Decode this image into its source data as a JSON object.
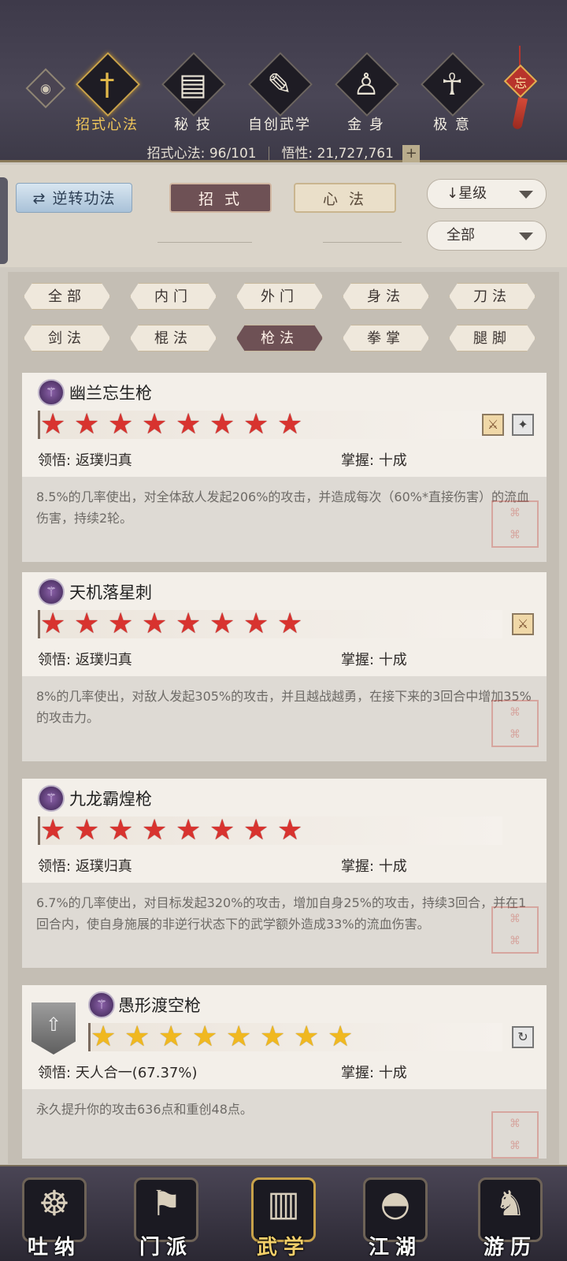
{
  "header": {
    "tabs": [
      {
        "label": "招式心法",
        "icon": "sword-icon",
        "glyph": "†",
        "active": true
      },
      {
        "label": "秘 技",
        "icon": "book-icon",
        "glyph": "▤",
        "active": false
      },
      {
        "label": "自创武学",
        "icon": "scroll-icon",
        "glyph": "✎",
        "active": false
      },
      {
        "label": "金 身",
        "icon": "meditation-icon",
        "glyph": "♙",
        "active": false
      },
      {
        "label": "极 意",
        "icon": "martial-pose-icon",
        "glyph": "☥",
        "active": false
      }
    ],
    "charm_text": "忘",
    "stats": {
      "moves_label": "招式心法:",
      "moves_value": "96/101",
      "insight_label": "悟性:",
      "insight_value": "21,727,761",
      "plus": "+"
    }
  },
  "controls": {
    "reverse_label": "逆转功法",
    "reverse_glyph": "⇄",
    "tab_moves": "招 式",
    "tab_mind": "心 法",
    "sort_value": "↓星级",
    "filter_value": "全部"
  },
  "filters": [
    {
      "label": "全部",
      "active": false
    },
    {
      "label": "内门",
      "active": false
    },
    {
      "label": "外门",
      "active": false
    },
    {
      "label": "身法",
      "active": false
    },
    {
      "label": "刀法",
      "active": false
    },
    {
      "label": "剑法",
      "active": false
    },
    {
      "label": "棍法",
      "active": false
    },
    {
      "label": "枪法",
      "active": true
    },
    {
      "label": "拳掌",
      "active": false
    },
    {
      "label": "腿脚",
      "active": false
    }
  ],
  "skills": [
    {
      "name": "幽兰忘生枪",
      "stars": 8,
      "star_color": "red",
      "comprehension_label": "领悟:",
      "comprehension_value": "返璞归真",
      "mastery_label": "掌握:",
      "mastery_value": "十成",
      "description": "8.5%的几率使出，对全体敌人发起206%的攻击，并造成每次（60%*直接伤害）的流血伤害，持续2轮。",
      "icons": [
        "spear-skill-icon",
        "blade-skill-icon"
      ]
    },
    {
      "name": "天机落星刺",
      "stars": 8,
      "star_color": "red",
      "comprehension_label": "领悟:",
      "comprehension_value": "返璞归真",
      "mastery_label": "掌握:",
      "mastery_value": "十成",
      "description": "8%的几率使出，对敌人发起305%的攻击，并且越战越勇，在接下来的3回合中增加35%的攻击力。",
      "icons": [
        "spear-skill-icon"
      ]
    },
    {
      "name": "九龙霸煌枪",
      "stars": 8,
      "star_color": "red",
      "comprehension_label": "领悟:",
      "comprehension_value": "返璞归真",
      "mastery_label": "掌握:",
      "mastery_value": "十成",
      "description": "6.7%的几率使出，对目标发起320%的攻击，增加自身25%的攻击，持续3回合，并在1回合内，使自身施展的非逆行状态下的武学额外造成33%的流血伤害。",
      "icons": []
    },
    {
      "name": "愚形渡空枪",
      "stars": 8,
      "star_color": "gold",
      "comprehension_label": "领悟:",
      "comprehension_value": "天人合一(67.37%)",
      "mastery_label": "掌握:",
      "mastery_value": "十成",
      "description": "永久提升你的攻击636点和重创48点。",
      "icons": [
        "swirl-skill-icon"
      ]
    }
  ],
  "bottom_nav": [
    {
      "label": "吐纳",
      "icon": "monk-icon",
      "glyph": "☸",
      "active": false
    },
    {
      "label": "门派",
      "icon": "sect-banner-icon",
      "glyph": "⚑",
      "active": false
    },
    {
      "label": "武学",
      "icon": "martial-book-icon",
      "glyph": "▥",
      "active": true
    },
    {
      "label": "江湖",
      "icon": "straw-hat-icon",
      "glyph": "◓",
      "active": false
    },
    {
      "label": "游历",
      "icon": "horse-icon",
      "glyph": "♞",
      "active": false
    }
  ],
  "colors": {
    "accent_gold": "#e2b94a",
    "active_tab": "#6e5155",
    "star_red": "#d8332f",
    "star_gold": "#f0b820"
  }
}
